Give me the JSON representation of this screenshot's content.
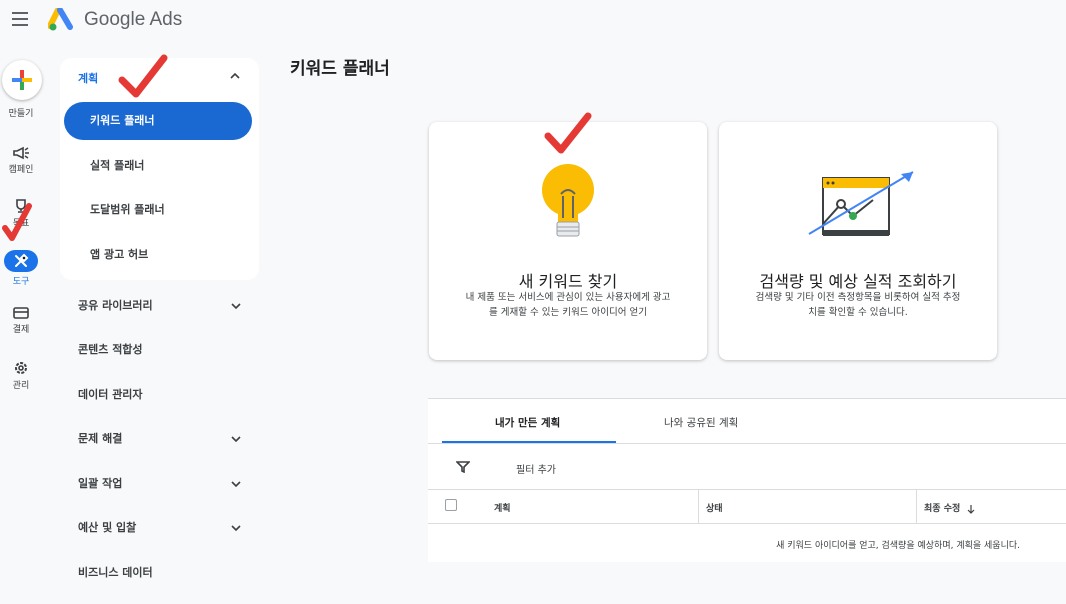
{
  "header": {
    "brand": "Google Ads"
  },
  "rail": {
    "create": "만들기",
    "campaigns": "캠페인",
    "goals": "목표",
    "tools": "도구",
    "billing": "결제",
    "admin": "관리"
  },
  "nav": {
    "planning": {
      "header": "계획",
      "items": [
        "키워드 플래너",
        "실적 플래너",
        "도달범위 플래너",
        "앱 광고 허브"
      ]
    },
    "items": [
      "공유 라이브러리",
      "콘텐츠 적합성",
      "데이터 관리자",
      "문제 해결",
      "일괄 작업",
      "예산 및 입찰",
      "비즈니스 데이터"
    ]
  },
  "main": {
    "title": "키워드 플래너",
    "cards": [
      {
        "title": "새 키워드 찾기",
        "desc1": "내 제품 또는 서비스에 관심이 있는 사용자에게 광고",
        "desc2": "를 게재할 수 있는 키워드 아이디어 얻기"
      },
      {
        "title": "검색량 및 예상 실적 조회하기",
        "desc1": "검색량 및 기타 이전 측정항목을 비롯하여 실적 추정",
        "desc2": "치를 확인할 수 있습니다."
      }
    ],
    "tabs": [
      "내가 만든 계획",
      "나와 공유된 계획"
    ],
    "filter_label": "필터 추가",
    "columns": [
      "계획",
      "상태",
      "최종 수정"
    ],
    "empty_message": "새 키워드 아이디어를 얻고, 검색량을 예상하며, 계획을 세웁니다."
  },
  "colors": {
    "accent": "#1a73e8",
    "active_nav": "#1a68d2",
    "annotation_check": "#e53935"
  }
}
